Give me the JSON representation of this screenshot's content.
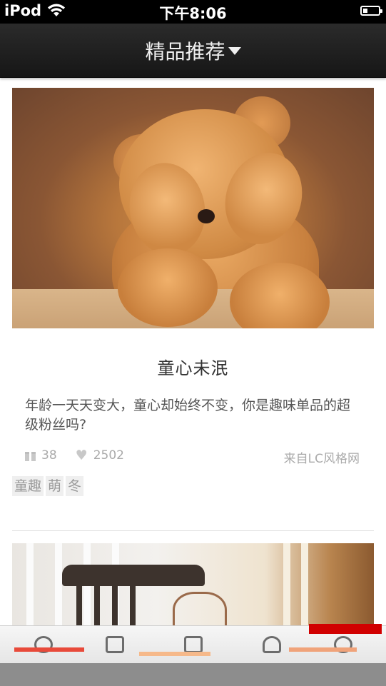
{
  "status_bar": {
    "carrier": "iPod",
    "time": "下午8:06",
    "battery_level": 0.3
  },
  "nav": {
    "title": "精品推荐"
  },
  "feed": {
    "cards": [
      {
        "title": "童心未泯",
        "description": "年龄一天天变大，童心却始终不变，你是趣味单品的超级粉丝吗?",
        "gift_count": "38",
        "like_count": "2502",
        "source": "来自LC风格网",
        "tags": [
          "童趣",
          "萌",
          "冬"
        ]
      }
    ]
  }
}
